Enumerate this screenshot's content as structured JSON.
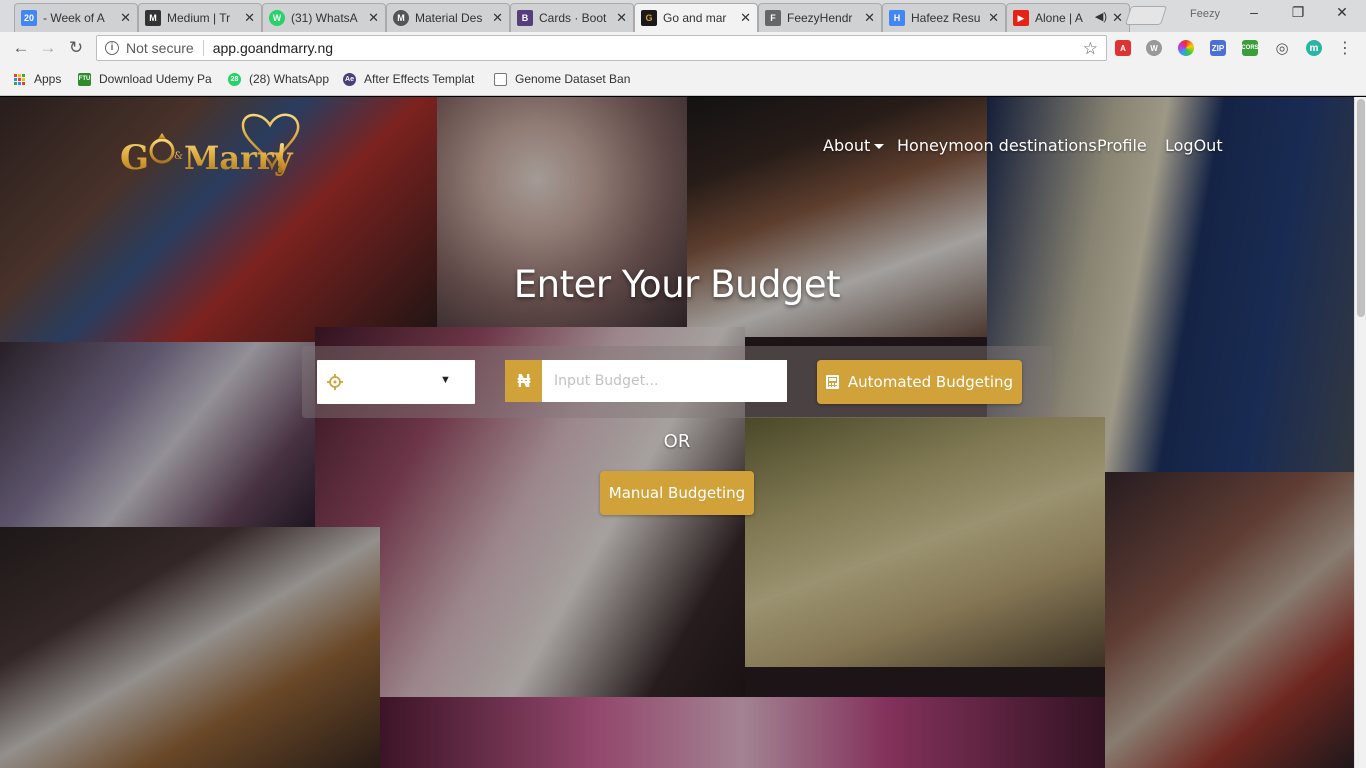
{
  "browser": {
    "tabs": [
      {
        "title": "- Week of A",
        "favicon_text": "20",
        "favicon_color": "#4285f4"
      },
      {
        "title": "Medium | Tr",
        "favicon_text": "M",
        "favicon_color": "#333333"
      },
      {
        "title": "(31) WhatsA",
        "favicon_text": "W",
        "favicon_color": "#25d366"
      },
      {
        "title": "Material Des",
        "favicon_text": "M",
        "favicon_color": "#555555"
      },
      {
        "title": "Cards · Boot",
        "favicon_text": "B",
        "favicon_color": "#563d7c"
      },
      {
        "title": "Go and mar",
        "favicon_text": "G",
        "favicon_color": "#1a1a1a"
      },
      {
        "title": "FeezyHendr",
        "favicon_text": "F",
        "favicon_color": "#666666"
      },
      {
        "title": "Hafeez Resu",
        "favicon_text": "H",
        "favicon_color": "#4285f4"
      },
      {
        "title": "Alone | A",
        "favicon_text": "▶",
        "favicon_color": "#e62117"
      }
    ],
    "active_tab_index": 5,
    "profile": "Feezy",
    "window_controls": {
      "minimize": "–",
      "maximize": "❐",
      "close": "✕"
    },
    "address": {
      "security": "Not secure",
      "url": "app.goandmarry.ng"
    },
    "extensions": [
      {
        "label": "A",
        "color": "#dd3333"
      },
      {
        "label": "W",
        "color": "#999999"
      },
      {
        "label": "●",
        "color": "#e8a400"
      },
      {
        "label": "ZIP",
        "color": "#4b6fd6"
      },
      {
        "label": "CORS",
        "color": "#3b9d3b"
      },
      {
        "label": "◎",
        "color": "#777777"
      },
      {
        "label": "m",
        "color": "#2bb3a3"
      }
    ],
    "bookmarks": [
      {
        "label": "Apps",
        "icon": "apps-grid-icon"
      },
      {
        "label": "Download Udemy Pa",
        "icon_text": "FTU",
        "icon_color": "#2e8b2e"
      },
      {
        "label": "(28) WhatsApp",
        "icon_text": "28",
        "icon_color": "#25d366"
      },
      {
        "label": "After Effects Templat",
        "icon_text": "Ae",
        "icon_color": "#4a3f7a"
      },
      {
        "label": "Genome Dataset Ban",
        "icon_text": "",
        "icon_color": "#ffffff"
      }
    ]
  },
  "site": {
    "logo_text": "Go&Marry",
    "nav": {
      "about": "About",
      "honeymoon": "Honeymoon destinations",
      "profile": "Profile",
      "logout": "LogOut"
    },
    "headline": "Enter Your Budget",
    "budget_form": {
      "currency_symbol": "₦",
      "placeholder": "Input Budget...",
      "automated_label": "Automated Budgeting",
      "or_text": "OR",
      "manual_label": "Manual Budgeting"
    },
    "accent_color": "#d1a23a"
  }
}
